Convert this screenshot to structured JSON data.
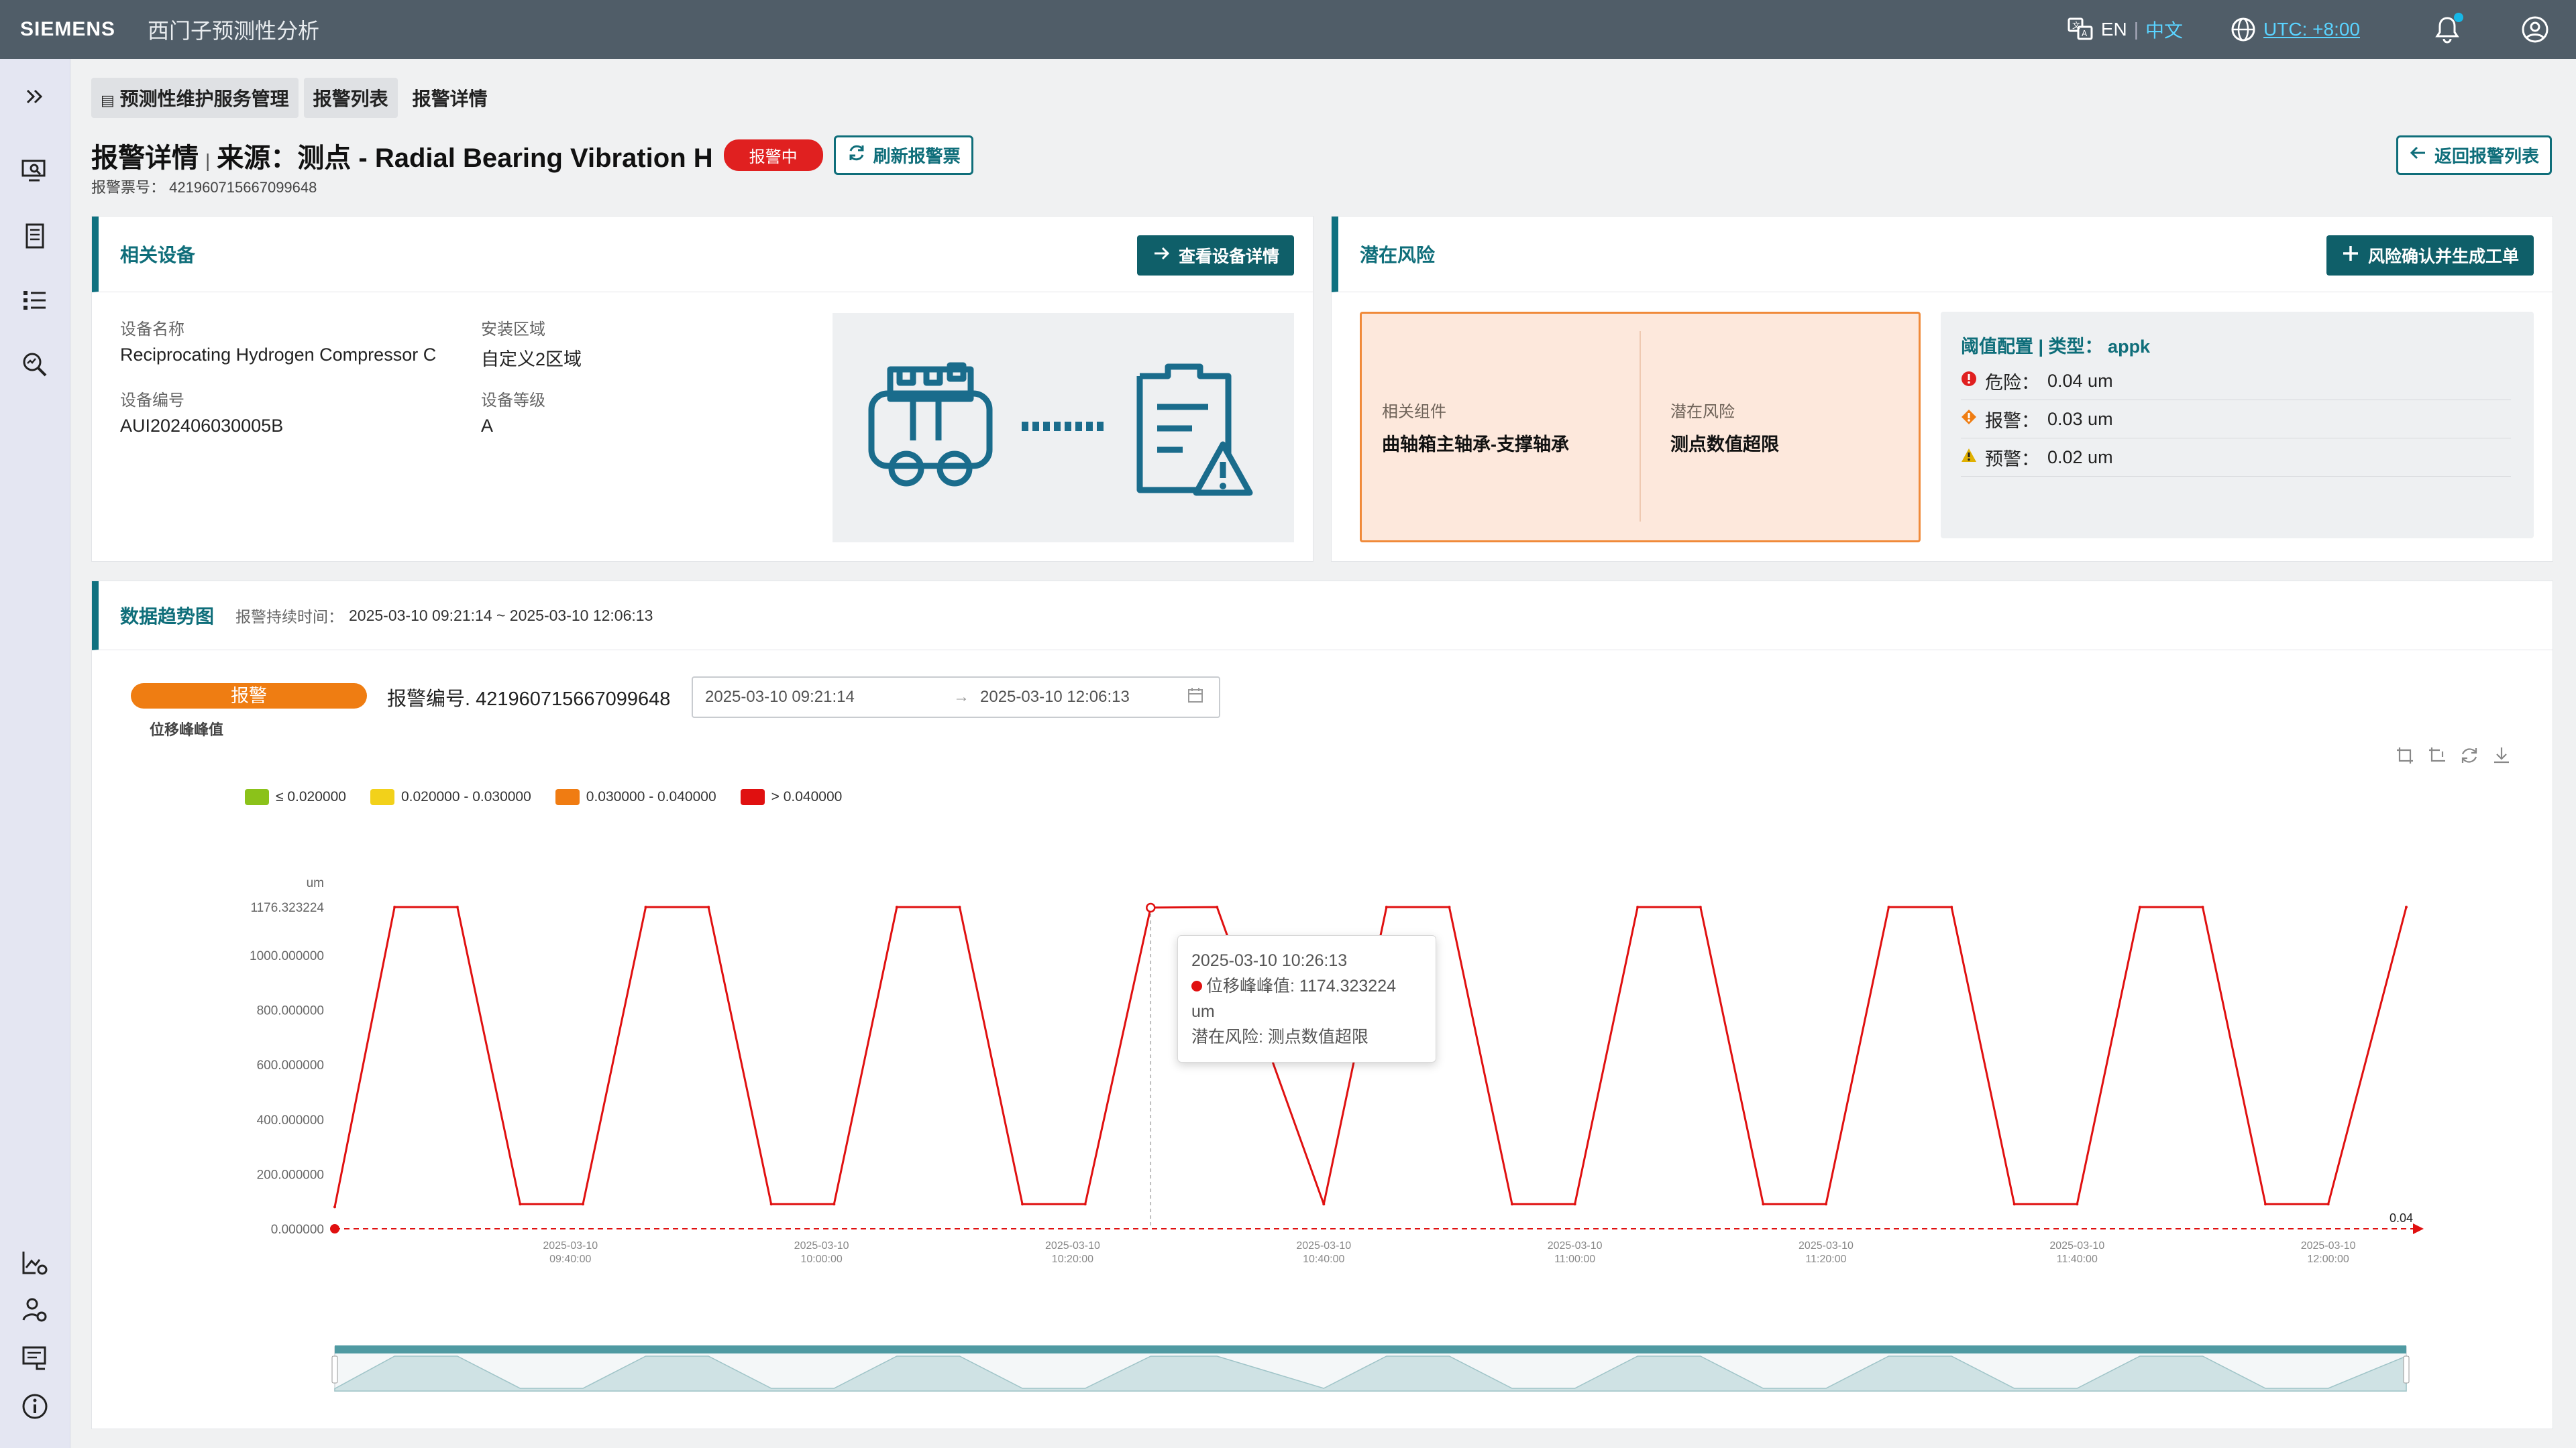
{
  "topbar": {
    "brand": "SIEMENS",
    "app_name": "西门子预测性分析",
    "lang_en": "EN",
    "lang_sep": "|",
    "lang_zh": "中文",
    "timezone": "UTC: +8:00"
  },
  "breadcrumb": [
    "预测性维护服务管理",
    "报警列表",
    "报警详情"
  ],
  "header": {
    "title": "报警详情",
    "sep": "|",
    "source": "来源：测点 - Radial Bearing Vibration H",
    "status": "报警中",
    "refresh_label": "刷新报警票",
    "ticket_label": "报警票号：",
    "ticket_no": "421960715667099648",
    "back_label": "返回报警列表"
  },
  "device": {
    "title": "相关设备",
    "view_btn": "查看设备详情",
    "name_label": "设备名称",
    "name_value": "Reciprocating Hydrogen Compressor C",
    "area_label": "安装区域",
    "area_value": "自定义2区域",
    "code_label": "设备编号",
    "code_value": "AUI202406030005B",
    "grade_label": "设备等级",
    "grade_value": "A"
  },
  "risk": {
    "title": "潜在风险",
    "confirm_btn": "风险确认并生成工单",
    "component_label": "相关组件",
    "component_value": "曲轴箱主轴承-支撑轴承",
    "risk_label": "潜在风险",
    "risk_value": "测点数值超限",
    "threshold_title": "阈值配置 | 类型： appk",
    "thresholds": [
      {
        "label": "危险：",
        "value": "0.04 um",
        "color": "#e02020"
      },
      {
        "label": "报警：",
        "value": "0.03 um",
        "color": "#ef7d12"
      },
      {
        "label": "预警：",
        "value": "0.02 um",
        "color": "#e0b000"
      }
    ]
  },
  "trend": {
    "title": "数据趋势图",
    "duration_label": "报警持续时间：",
    "duration_value": "2025-03-10 09:21:14 ~ 2025-03-10 12:06:13",
    "alarm_tag": "报警",
    "alarm_no": "报警编号. 421960715667099648",
    "metric_name": "位移峰峰值",
    "range_start": "2025-03-10 09:21:14",
    "range_arrow": "→",
    "range_end": "2025-03-10 12:06:13",
    "legend": [
      {
        "label": "≤ 0.020000",
        "color": "#8bc21a"
      },
      {
        "label": "0.020000 - 0.030000",
        "color": "#f2d11a"
      },
      {
        "label": "0.030000 - 0.040000",
        "color": "#f07c12"
      },
      {
        "label": "> 0.040000",
        "color": "#e01010"
      }
    ],
    "tooltip": {
      "time": "2025-03-10 10:26:13",
      "line1": "位移峰峰值: 1174.323224 um",
      "line2": "潜在风险: 测点数值超限"
    }
  },
  "chart_data": {
    "type": "line",
    "ylabel": "um",
    "yticks": [
      "0.000000",
      "200.000000",
      "400.000000",
      "600.000000",
      "800.000000",
      "1000.000000",
      "1176.323224"
    ],
    "ylim": [
      0,
      1176.323224
    ],
    "xticks": [
      [
        "2025-03-10",
        "09:40:00"
      ],
      [
        "2025-03-10",
        "10:00:00"
      ],
      [
        "2025-03-10",
        "10:20:00"
      ],
      [
        "2025-03-10",
        "10:40:00"
      ],
      [
        "2025-03-10",
        "11:00:00"
      ],
      [
        "2025-03-10",
        "11:20:00"
      ],
      [
        "2025-03-10",
        "11:40:00"
      ],
      [
        "2025-03-10",
        "12:00:00"
      ]
    ],
    "threshold_label": "0.04",
    "series": [
      {
        "unit": "um",
        "x": [
          "09:21:14",
          "09:26:00",
          "09:31:00",
          "09:36:00",
          "09:41:00",
          "09:46:00",
          "09:51:00",
          "09:56:00",
          "10:01:00",
          "10:06:00",
          "10:11:00",
          "10:16:00",
          "10:21:00",
          "10:26:13",
          "10:31:30",
          "10:40:00",
          "10:45:00",
          "10:50:00",
          "10:55:00",
          "11:00:00",
          "11:05:00",
          "11:10:00",
          "11:15:00",
          "11:20:00",
          "11:25:00",
          "11:30:00",
          "11:35:00",
          "11:40:00",
          "11:45:00",
          "11:50:00",
          "11:55:00",
          "12:00:00",
          "12:06:13"
        ],
        "y": [
          80,
          1176,
          1176,
          90,
          90,
          1176,
          1176,
          90,
          90,
          1176,
          1176,
          90,
          90,
          1174,
          1176,
          90,
          1176,
          1176,
          90,
          90,
          1176,
          1176,
          90,
          90,
          1176,
          1176,
          90,
          90,
          1176,
          1176,
          90,
          90,
          1176
        ]
      }
    ]
  }
}
